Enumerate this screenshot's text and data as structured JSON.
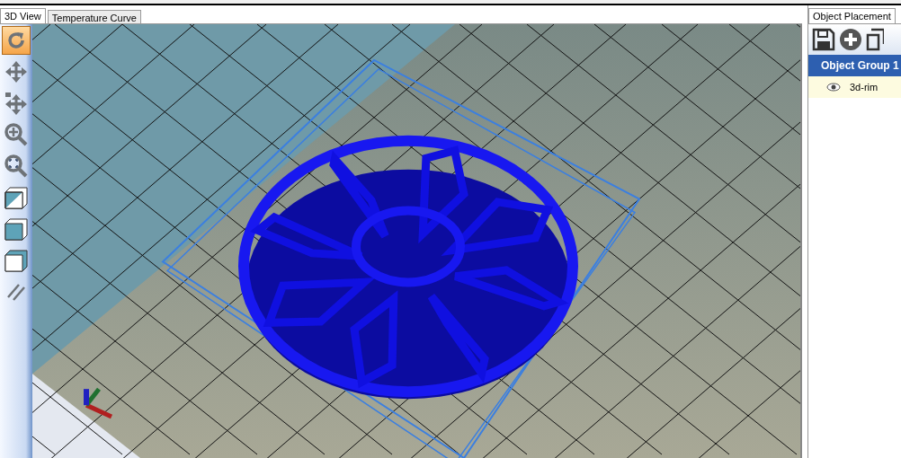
{
  "tabs": [
    {
      "label": "3D View",
      "selected": true
    },
    {
      "label": "Temperature Curve",
      "selected": false
    }
  ],
  "tools": [
    {
      "kind": "rotate",
      "selected": true
    },
    {
      "kind": "move",
      "selected": false
    },
    {
      "kind": "move-object",
      "selected": false
    },
    {
      "kind": "zoom",
      "selected": false
    },
    {
      "kind": "fit",
      "selected": false
    },
    {
      "kind": "iso",
      "selected": false
    },
    {
      "kind": "front",
      "selected": false
    },
    {
      "kind": "wire",
      "selected": false
    },
    {
      "kind": "slash",
      "selected": false
    }
  ],
  "panel": {
    "tab": {
      "label": "Object Placement",
      "selected": true
    },
    "group": {
      "title": "Object Group 1"
    },
    "objects": [
      {
        "name": "3d-rim",
        "visible": true
      }
    ]
  }
}
